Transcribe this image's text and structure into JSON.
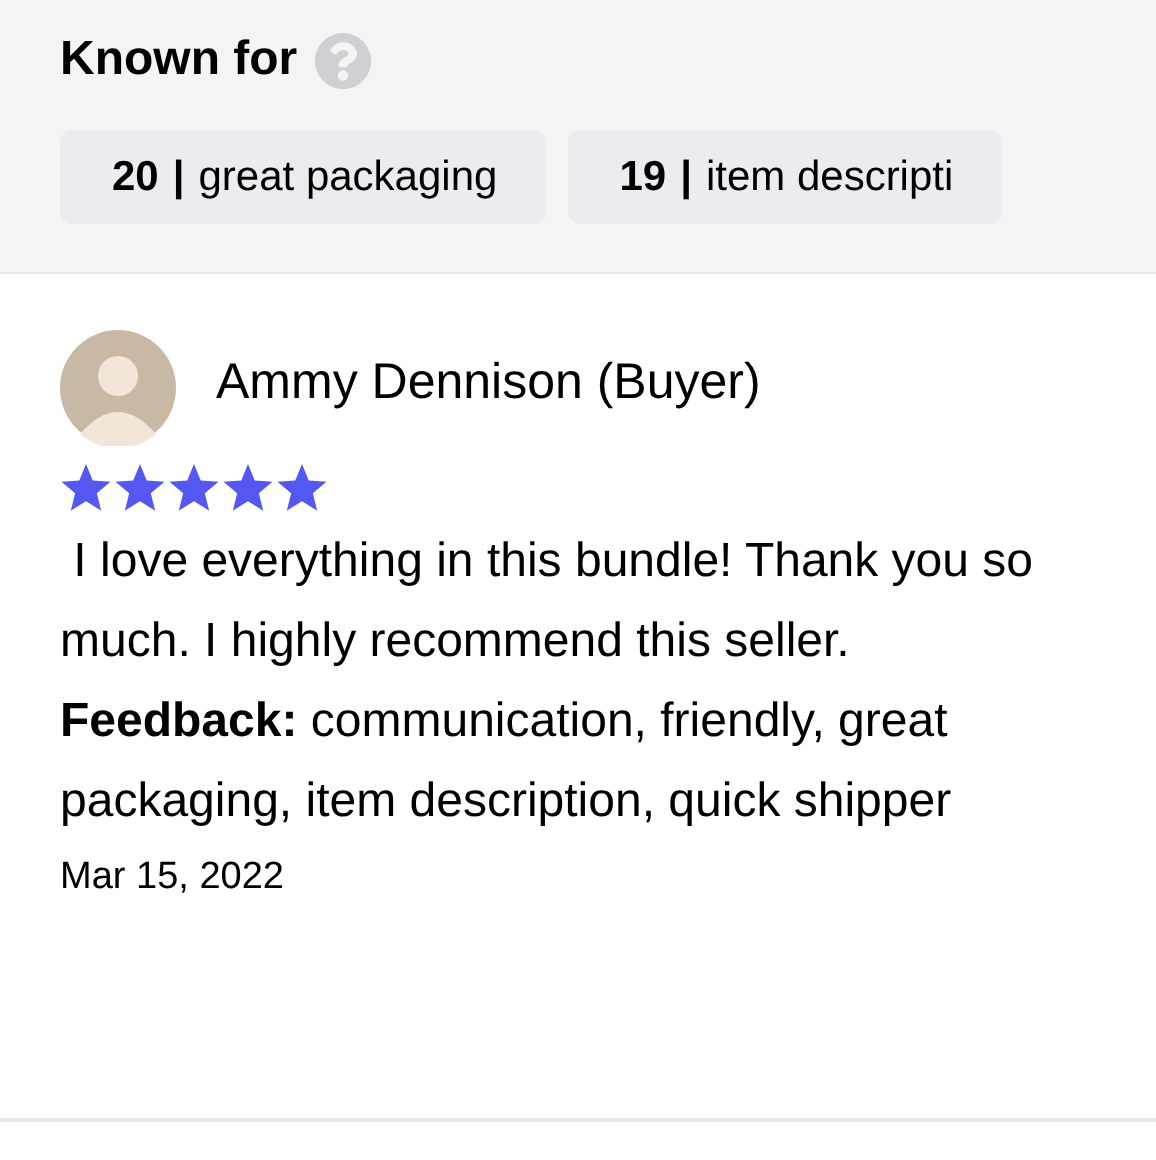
{
  "known_for": {
    "title": "Known for",
    "tags": [
      {
        "count": "20",
        "separator": "|",
        "label": "great packaging"
      },
      {
        "count": "19",
        "separator": "|",
        "label": "item descripti"
      }
    ]
  },
  "review": {
    "reviewer": "Ammy Dennison (Buyer)",
    "stars": 5,
    "text": " I love everything in this bundle! Thank you so much. I highly recommend this seller.",
    "feedback": "**Feedback:** communication, friendly, great packaging, item description, quick shipper",
    "date": "Mar 15, 2022"
  }
}
